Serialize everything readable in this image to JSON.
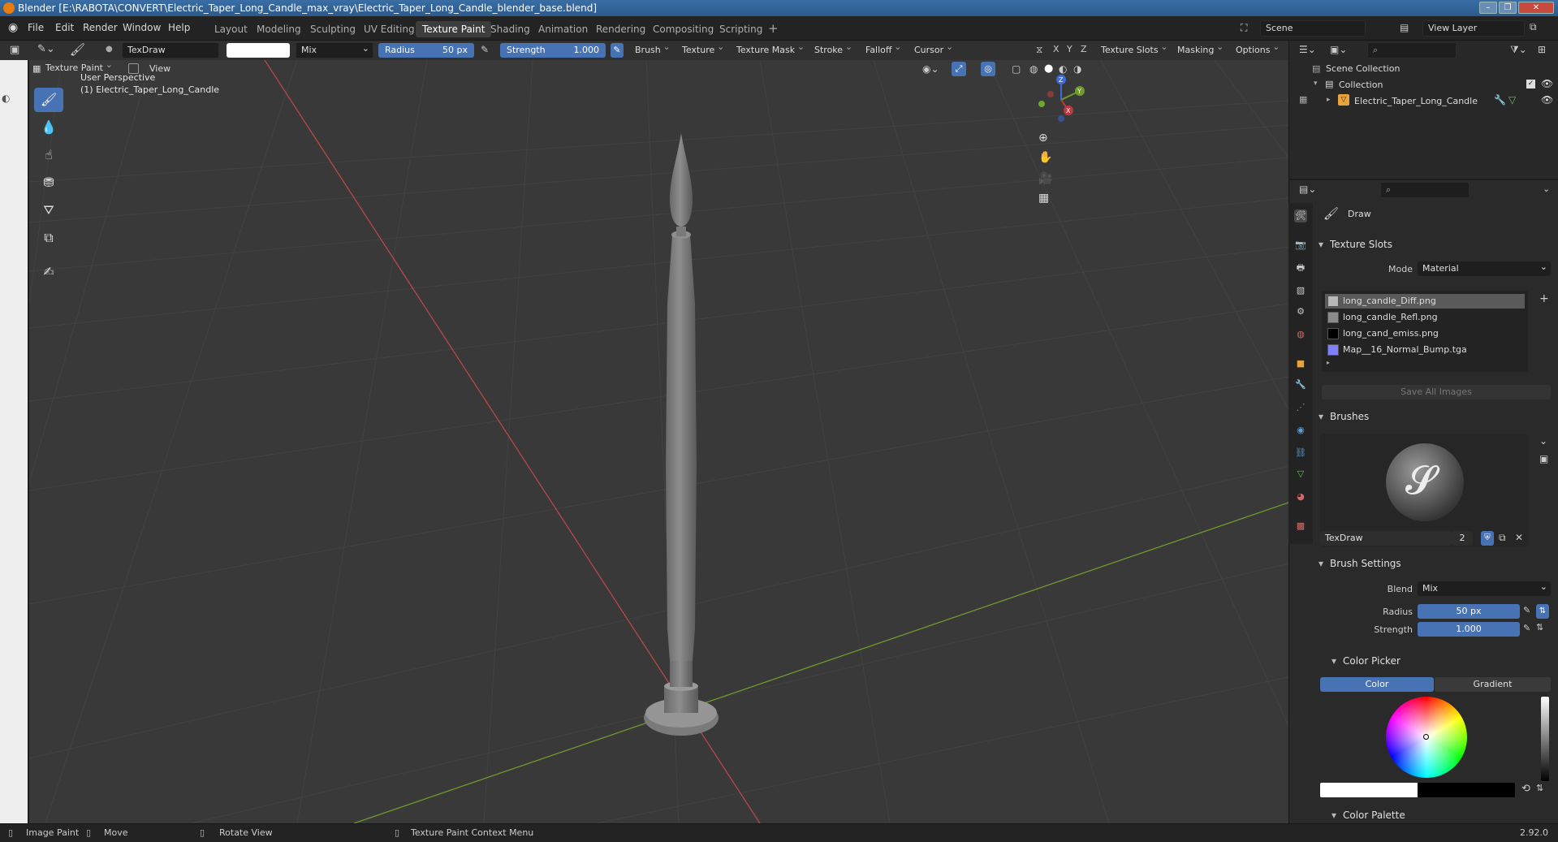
{
  "title": "Blender [E:\\RABOTA\\CONVERT\\Electric_Taper_Long_Candle_max_vray\\Electric_Taper_Long_Candle_blender_base.blend]",
  "menu": [
    "File",
    "Edit",
    "Render",
    "Window",
    "Help"
  ],
  "workspaces": [
    "Layout",
    "Modeling",
    "Sculpting",
    "UV Editing",
    "Texture Paint",
    "Shading",
    "Animation",
    "Rendering",
    "Compositing",
    "Scripting"
  ],
  "active_workspace": "Texture Paint",
  "scene": {
    "label": "Scene",
    "view_layer": "View Layer"
  },
  "toolheader": {
    "brush_name": "TexDraw",
    "blend": "Mix",
    "radius_label": "Radius",
    "radius_value": "50 px",
    "strength_label": "Strength",
    "strength_value": "1.000",
    "dropdowns": [
      "Brush",
      "Texture",
      "Texture Mask",
      "Stroke",
      "Falloff",
      "Cursor"
    ],
    "axes": [
      "X",
      "Y",
      "Z"
    ],
    "right_dropdowns": [
      "Texture Slots",
      "Masking",
      "Options"
    ]
  },
  "viewheader": {
    "mode": "Texture Paint",
    "view": "View"
  },
  "viewport": {
    "perspective": "User Perspective",
    "object": "(1) Electric_Taper_Long_Candle",
    "gizmo": {
      "x": "X",
      "y": "Y",
      "z": "Z"
    }
  },
  "outliner": {
    "root": "Scene Collection",
    "collection": "Collection",
    "object": "Electric_Taper_Long_Candle"
  },
  "properties": {
    "tool_name": "Draw",
    "texture_slots": {
      "header": "Texture Slots",
      "mode_label": "Mode",
      "mode_value": "Material",
      "slots": [
        {
          "name": "long_candle_Diff.png",
          "color": "#b8b8b8"
        },
        {
          "name": "long_candle_Refl.png",
          "color": "#8a8a8a"
        },
        {
          "name": "long_cand_emiss.png",
          "color": "#000000"
        },
        {
          "name": "Map__16_Normal_Bump.tga",
          "color": "#8080ff"
        }
      ],
      "save_all": "Save All Images"
    },
    "brushes": {
      "header": "Brushes",
      "name": "TexDraw",
      "users": "2"
    },
    "brush_settings": {
      "header": "Brush Settings",
      "blend_label": "Blend",
      "blend_value": "Mix",
      "radius_label": "Radius",
      "radius_value": "50 px",
      "strength_label": "Strength",
      "strength_value": "1.000"
    },
    "color_picker": {
      "header": "Color Picker",
      "tab_color": "Color",
      "tab_gradient": "Gradient"
    },
    "color_palette": {
      "header": "Color Palette"
    }
  },
  "statusbar": {
    "image_paint": "Image Paint",
    "move": "Move",
    "rotate": "Rotate View",
    "context": "Texture Paint Context Menu",
    "version": "2.92.0"
  },
  "colors": {
    "accent": "#4772b3",
    "x_axis": "#b84848",
    "y_axis": "#6f9a2c"
  }
}
